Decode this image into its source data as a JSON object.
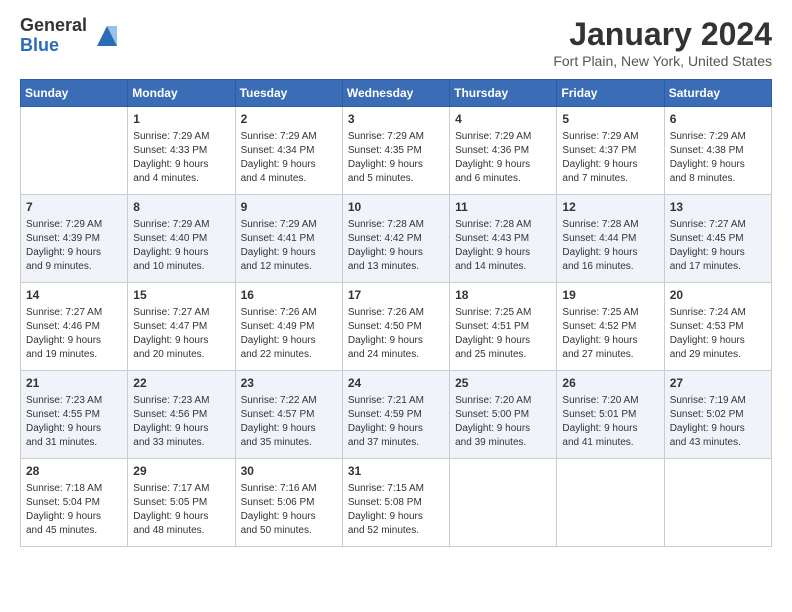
{
  "header": {
    "logo_general": "General",
    "logo_blue": "Blue",
    "title": "January 2024",
    "location": "Fort Plain, New York, United States"
  },
  "calendar": {
    "days_of_week": [
      "Sunday",
      "Monday",
      "Tuesday",
      "Wednesday",
      "Thursday",
      "Friday",
      "Saturday"
    ],
    "weeks": [
      [
        {
          "day": "",
          "info": ""
        },
        {
          "day": "1",
          "info": "Sunrise: 7:29 AM\nSunset: 4:33 PM\nDaylight: 9 hours\nand 4 minutes."
        },
        {
          "day": "2",
          "info": "Sunrise: 7:29 AM\nSunset: 4:34 PM\nDaylight: 9 hours\nand 4 minutes."
        },
        {
          "day": "3",
          "info": "Sunrise: 7:29 AM\nSunset: 4:35 PM\nDaylight: 9 hours\nand 5 minutes."
        },
        {
          "day": "4",
          "info": "Sunrise: 7:29 AM\nSunset: 4:36 PM\nDaylight: 9 hours\nand 6 minutes."
        },
        {
          "day": "5",
          "info": "Sunrise: 7:29 AM\nSunset: 4:37 PM\nDaylight: 9 hours\nand 7 minutes."
        },
        {
          "day": "6",
          "info": "Sunrise: 7:29 AM\nSunset: 4:38 PM\nDaylight: 9 hours\nand 8 minutes."
        }
      ],
      [
        {
          "day": "7",
          "info": "Sunrise: 7:29 AM\nSunset: 4:39 PM\nDaylight: 9 hours\nand 9 minutes."
        },
        {
          "day": "8",
          "info": "Sunrise: 7:29 AM\nSunset: 4:40 PM\nDaylight: 9 hours\nand 10 minutes."
        },
        {
          "day": "9",
          "info": "Sunrise: 7:29 AM\nSunset: 4:41 PM\nDaylight: 9 hours\nand 12 minutes."
        },
        {
          "day": "10",
          "info": "Sunrise: 7:28 AM\nSunset: 4:42 PM\nDaylight: 9 hours\nand 13 minutes."
        },
        {
          "day": "11",
          "info": "Sunrise: 7:28 AM\nSunset: 4:43 PM\nDaylight: 9 hours\nand 14 minutes."
        },
        {
          "day": "12",
          "info": "Sunrise: 7:28 AM\nSunset: 4:44 PM\nDaylight: 9 hours\nand 16 minutes."
        },
        {
          "day": "13",
          "info": "Sunrise: 7:27 AM\nSunset: 4:45 PM\nDaylight: 9 hours\nand 17 minutes."
        }
      ],
      [
        {
          "day": "14",
          "info": "Sunrise: 7:27 AM\nSunset: 4:46 PM\nDaylight: 9 hours\nand 19 minutes."
        },
        {
          "day": "15",
          "info": "Sunrise: 7:27 AM\nSunset: 4:47 PM\nDaylight: 9 hours\nand 20 minutes."
        },
        {
          "day": "16",
          "info": "Sunrise: 7:26 AM\nSunset: 4:49 PM\nDaylight: 9 hours\nand 22 minutes."
        },
        {
          "day": "17",
          "info": "Sunrise: 7:26 AM\nSunset: 4:50 PM\nDaylight: 9 hours\nand 24 minutes."
        },
        {
          "day": "18",
          "info": "Sunrise: 7:25 AM\nSunset: 4:51 PM\nDaylight: 9 hours\nand 25 minutes."
        },
        {
          "day": "19",
          "info": "Sunrise: 7:25 AM\nSunset: 4:52 PM\nDaylight: 9 hours\nand 27 minutes."
        },
        {
          "day": "20",
          "info": "Sunrise: 7:24 AM\nSunset: 4:53 PM\nDaylight: 9 hours\nand 29 minutes."
        }
      ],
      [
        {
          "day": "21",
          "info": "Sunrise: 7:23 AM\nSunset: 4:55 PM\nDaylight: 9 hours\nand 31 minutes."
        },
        {
          "day": "22",
          "info": "Sunrise: 7:23 AM\nSunset: 4:56 PM\nDaylight: 9 hours\nand 33 minutes."
        },
        {
          "day": "23",
          "info": "Sunrise: 7:22 AM\nSunset: 4:57 PM\nDaylight: 9 hours\nand 35 minutes."
        },
        {
          "day": "24",
          "info": "Sunrise: 7:21 AM\nSunset: 4:59 PM\nDaylight: 9 hours\nand 37 minutes."
        },
        {
          "day": "25",
          "info": "Sunrise: 7:20 AM\nSunset: 5:00 PM\nDaylight: 9 hours\nand 39 minutes."
        },
        {
          "day": "26",
          "info": "Sunrise: 7:20 AM\nSunset: 5:01 PM\nDaylight: 9 hours\nand 41 minutes."
        },
        {
          "day": "27",
          "info": "Sunrise: 7:19 AM\nSunset: 5:02 PM\nDaylight: 9 hours\nand 43 minutes."
        }
      ],
      [
        {
          "day": "28",
          "info": "Sunrise: 7:18 AM\nSunset: 5:04 PM\nDaylight: 9 hours\nand 45 minutes."
        },
        {
          "day": "29",
          "info": "Sunrise: 7:17 AM\nSunset: 5:05 PM\nDaylight: 9 hours\nand 48 minutes."
        },
        {
          "day": "30",
          "info": "Sunrise: 7:16 AM\nSunset: 5:06 PM\nDaylight: 9 hours\nand 50 minutes."
        },
        {
          "day": "31",
          "info": "Sunrise: 7:15 AM\nSunset: 5:08 PM\nDaylight: 9 hours\nand 52 minutes."
        },
        {
          "day": "",
          "info": ""
        },
        {
          "day": "",
          "info": ""
        },
        {
          "day": "",
          "info": ""
        }
      ]
    ]
  }
}
